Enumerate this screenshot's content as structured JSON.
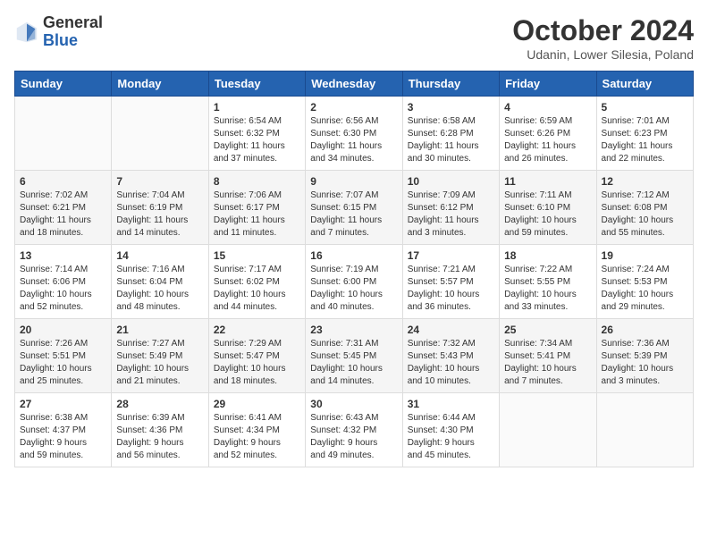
{
  "header": {
    "logo_general": "General",
    "logo_blue": "Blue",
    "month_title": "October 2024",
    "subtitle": "Udanin, Lower Silesia, Poland"
  },
  "days_of_week": [
    "Sunday",
    "Monday",
    "Tuesday",
    "Wednesday",
    "Thursday",
    "Friday",
    "Saturday"
  ],
  "weeks": [
    [
      {
        "day": "",
        "info": ""
      },
      {
        "day": "",
        "info": ""
      },
      {
        "day": "1",
        "info": "Sunrise: 6:54 AM\nSunset: 6:32 PM\nDaylight: 11 hours\nand 37 minutes."
      },
      {
        "day": "2",
        "info": "Sunrise: 6:56 AM\nSunset: 6:30 PM\nDaylight: 11 hours\nand 34 minutes."
      },
      {
        "day": "3",
        "info": "Sunrise: 6:58 AM\nSunset: 6:28 PM\nDaylight: 11 hours\nand 30 minutes."
      },
      {
        "day": "4",
        "info": "Sunrise: 6:59 AM\nSunset: 6:26 PM\nDaylight: 11 hours\nand 26 minutes."
      },
      {
        "day": "5",
        "info": "Sunrise: 7:01 AM\nSunset: 6:23 PM\nDaylight: 11 hours\nand 22 minutes."
      }
    ],
    [
      {
        "day": "6",
        "info": "Sunrise: 7:02 AM\nSunset: 6:21 PM\nDaylight: 11 hours\nand 18 minutes."
      },
      {
        "day": "7",
        "info": "Sunrise: 7:04 AM\nSunset: 6:19 PM\nDaylight: 11 hours\nand 14 minutes."
      },
      {
        "day": "8",
        "info": "Sunrise: 7:06 AM\nSunset: 6:17 PM\nDaylight: 11 hours\nand 11 minutes."
      },
      {
        "day": "9",
        "info": "Sunrise: 7:07 AM\nSunset: 6:15 PM\nDaylight: 11 hours\nand 7 minutes."
      },
      {
        "day": "10",
        "info": "Sunrise: 7:09 AM\nSunset: 6:12 PM\nDaylight: 11 hours\nand 3 minutes."
      },
      {
        "day": "11",
        "info": "Sunrise: 7:11 AM\nSunset: 6:10 PM\nDaylight: 10 hours\nand 59 minutes."
      },
      {
        "day": "12",
        "info": "Sunrise: 7:12 AM\nSunset: 6:08 PM\nDaylight: 10 hours\nand 55 minutes."
      }
    ],
    [
      {
        "day": "13",
        "info": "Sunrise: 7:14 AM\nSunset: 6:06 PM\nDaylight: 10 hours\nand 52 minutes."
      },
      {
        "day": "14",
        "info": "Sunrise: 7:16 AM\nSunset: 6:04 PM\nDaylight: 10 hours\nand 48 minutes."
      },
      {
        "day": "15",
        "info": "Sunrise: 7:17 AM\nSunset: 6:02 PM\nDaylight: 10 hours\nand 44 minutes."
      },
      {
        "day": "16",
        "info": "Sunrise: 7:19 AM\nSunset: 6:00 PM\nDaylight: 10 hours\nand 40 minutes."
      },
      {
        "day": "17",
        "info": "Sunrise: 7:21 AM\nSunset: 5:57 PM\nDaylight: 10 hours\nand 36 minutes."
      },
      {
        "day": "18",
        "info": "Sunrise: 7:22 AM\nSunset: 5:55 PM\nDaylight: 10 hours\nand 33 minutes."
      },
      {
        "day": "19",
        "info": "Sunrise: 7:24 AM\nSunset: 5:53 PM\nDaylight: 10 hours\nand 29 minutes."
      }
    ],
    [
      {
        "day": "20",
        "info": "Sunrise: 7:26 AM\nSunset: 5:51 PM\nDaylight: 10 hours\nand 25 minutes."
      },
      {
        "day": "21",
        "info": "Sunrise: 7:27 AM\nSunset: 5:49 PM\nDaylight: 10 hours\nand 21 minutes."
      },
      {
        "day": "22",
        "info": "Sunrise: 7:29 AM\nSunset: 5:47 PM\nDaylight: 10 hours\nand 18 minutes."
      },
      {
        "day": "23",
        "info": "Sunrise: 7:31 AM\nSunset: 5:45 PM\nDaylight: 10 hours\nand 14 minutes."
      },
      {
        "day": "24",
        "info": "Sunrise: 7:32 AM\nSunset: 5:43 PM\nDaylight: 10 hours\nand 10 minutes."
      },
      {
        "day": "25",
        "info": "Sunrise: 7:34 AM\nSunset: 5:41 PM\nDaylight: 10 hours\nand 7 minutes."
      },
      {
        "day": "26",
        "info": "Sunrise: 7:36 AM\nSunset: 5:39 PM\nDaylight: 10 hours\nand 3 minutes."
      }
    ],
    [
      {
        "day": "27",
        "info": "Sunrise: 6:38 AM\nSunset: 4:37 PM\nDaylight: 9 hours\nand 59 minutes."
      },
      {
        "day": "28",
        "info": "Sunrise: 6:39 AM\nSunset: 4:36 PM\nDaylight: 9 hours\nand 56 minutes."
      },
      {
        "day": "29",
        "info": "Sunrise: 6:41 AM\nSunset: 4:34 PM\nDaylight: 9 hours\nand 52 minutes."
      },
      {
        "day": "30",
        "info": "Sunrise: 6:43 AM\nSunset: 4:32 PM\nDaylight: 9 hours\nand 49 minutes."
      },
      {
        "day": "31",
        "info": "Sunrise: 6:44 AM\nSunset: 4:30 PM\nDaylight: 9 hours\nand 45 minutes."
      },
      {
        "day": "",
        "info": ""
      },
      {
        "day": "",
        "info": ""
      }
    ]
  ]
}
